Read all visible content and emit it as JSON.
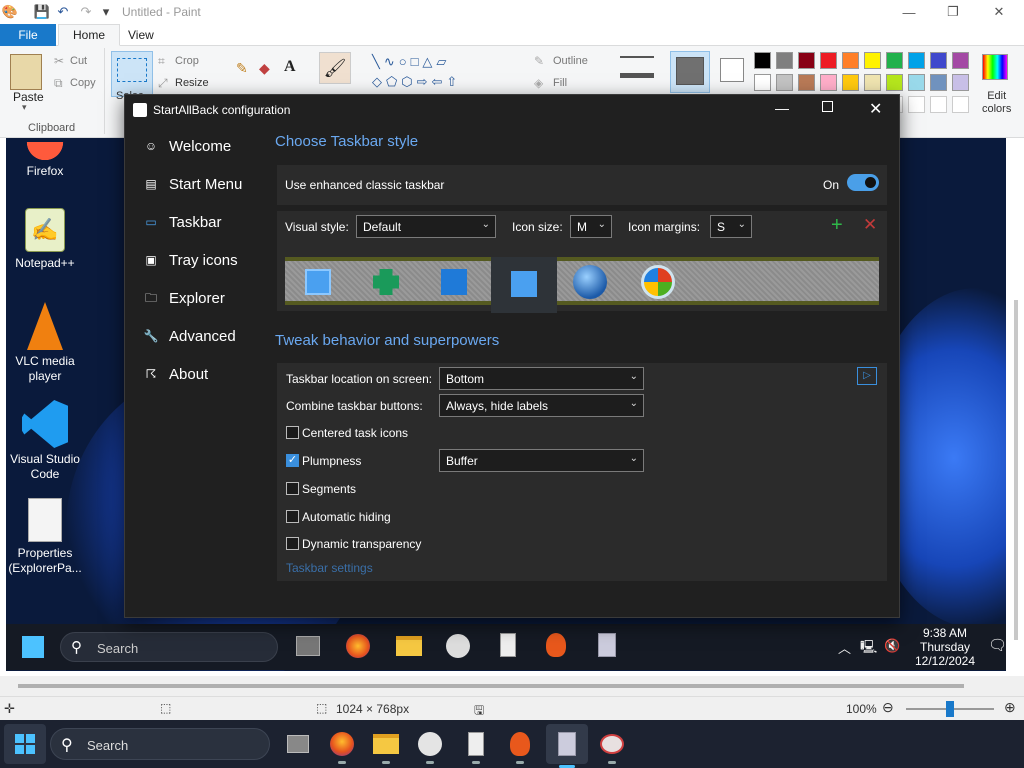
{
  "paint": {
    "title": "Untitled - Paint",
    "tabs": {
      "file": "File",
      "home": "Home",
      "view": "View"
    },
    "clipboard": {
      "paste": "Paste",
      "cut": "Cut",
      "copy": "Copy",
      "group": "Clipboard"
    },
    "image": {
      "crop": "Crop",
      "resize": "Resize",
      "select": "Selec"
    },
    "shapes": {
      "outline": "Outline",
      "fill": "Fill"
    },
    "colors": {
      "edit": "Edit colors",
      "edit1": "Edit",
      "edit2": "colors"
    },
    "status": {
      "dimensions": "1024 × 768px",
      "zoom": "100%"
    }
  },
  "desktop": {
    "icons": [
      {
        "label": "Firefox"
      },
      {
        "label": "Notepad++"
      },
      {
        "label": "VLC media player"
      },
      {
        "label": "Visual Studio Code"
      },
      {
        "label": "Properties (ExplorerPa..."
      }
    ],
    "inner_taskbar": {
      "search": "Search",
      "clock_time": "9:38 AM",
      "clock_day": "Thursday",
      "clock_date": "12/12/2024"
    }
  },
  "sab": {
    "title": "StartAllBack configuration",
    "nav": [
      "Welcome",
      "Start Menu",
      "Taskbar",
      "Tray icons",
      "Explorer",
      "Advanced",
      "About"
    ],
    "active_nav": "Taskbar",
    "section1": "Choose Taskbar style",
    "enhanced_label": "Use enhanced classic taskbar",
    "enhanced_state": "On",
    "visual_style_label": "Visual style:",
    "visual_style_value": "Default",
    "icon_size_label": "Icon size:",
    "icon_size_value": "M",
    "icon_margins_label": "Icon margins:",
    "icon_margins_value": "S",
    "section2": "Tweak behavior and superpowers",
    "location_label": "Taskbar location on screen:",
    "location_value": "Bottom",
    "combine_label": "Combine taskbar buttons:",
    "combine_value": "Always, hide labels",
    "centered_label": "Centered task icons",
    "plumpness_label": "Plumpness",
    "plumpness_value": "Buffer",
    "segments_label": "Segments",
    "autohide_label": "Automatic hiding",
    "dynamic_label": "Dynamic transparency",
    "settings_link": "Taskbar settings"
  },
  "taskbar": {
    "search": "Search"
  },
  "palette": [
    "#000000",
    "#7f7f7f",
    "#880015",
    "#ed1c24",
    "#ff7f27",
    "#fff200",
    "#22b14c",
    "#00a2e8",
    "#3f48cc",
    "#a349a4",
    "#ffffff",
    "#c3c3c3",
    "#b97a57",
    "#ffaec9",
    "#ffc90e",
    "#efe4b0",
    "#b5e61d",
    "#99d9ea",
    "#7092be",
    "#c8bfe7"
  ],
  "accent": "#4a9fe8"
}
